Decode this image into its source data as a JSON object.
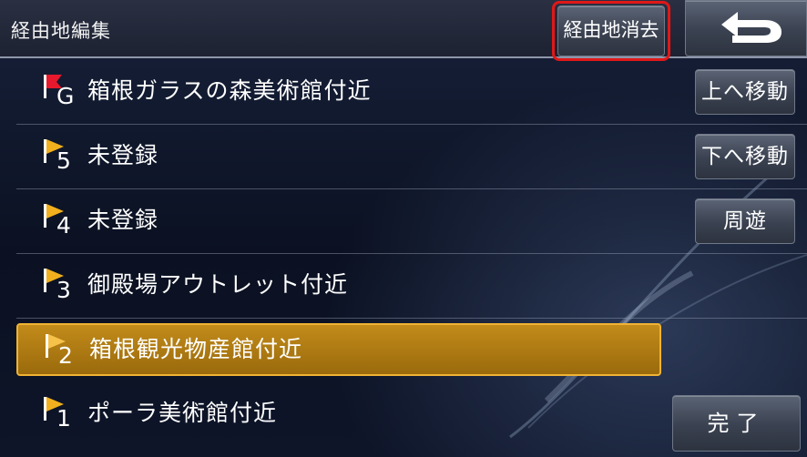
{
  "header": {
    "title": "経由地編集",
    "clear_button": "経由地消去",
    "back_icon": "return-arrow-icon"
  },
  "waypoints": [
    {
      "marker": "G",
      "label": "箱根ガラスの森美術館付近",
      "flag_color": "#e8192c",
      "selected": false
    },
    {
      "marker": "5",
      "label": "未登録",
      "flag_color": "#f2b01e",
      "selected": false
    },
    {
      "marker": "4",
      "label": "未登録",
      "flag_color": "#f2b01e",
      "selected": false
    },
    {
      "marker": "3",
      "label": "御殿場アウトレット付近",
      "flag_color": "#f2b01e",
      "selected": false
    },
    {
      "marker": "2",
      "label": "箱根観光物産館付近",
      "flag_color": "#f2b01e",
      "selected": true
    },
    {
      "marker": "1",
      "label": "ポーラ美術館付近",
      "flag_color": "#f2b01e",
      "selected": false
    }
  ],
  "side_buttons": {
    "move_up": "上へ移動",
    "move_down": "下へ移動",
    "round_trip": "周遊",
    "done": "完了"
  },
  "colors": {
    "highlight": "#b07a12",
    "clear_button_outline": "#e01818"
  }
}
